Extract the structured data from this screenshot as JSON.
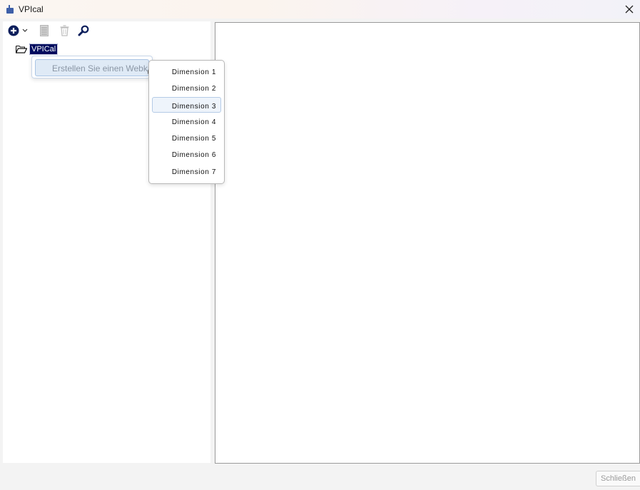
{
  "window": {
    "title": "VPIcal",
    "icon": "app-thumb-icon",
    "close_icon": "close-icon"
  },
  "toolbar": {
    "add_icon": "plus-circle-icon",
    "add_dropdown_icon": "chevron-down-icon",
    "edit_icon": "document-icon",
    "delete_icon": "trash-icon",
    "search_icon": "magnifier-icon"
  },
  "tree": {
    "root_icon": "open-folder-icon",
    "root_label": "VPICal"
  },
  "context_menu": {
    "items": [
      {
        "label": "Erstellen Sie einen Webkalender",
        "has_submenu": true
      }
    ]
  },
  "submenu": {
    "items": [
      {
        "label": "Dimension 1",
        "highlighted": false
      },
      {
        "label": "Dimension 2",
        "highlighted": false
      },
      {
        "label": "Dimension 3",
        "highlighted": true
      },
      {
        "label": "Dimension 4",
        "highlighted": false
      },
      {
        "label": "Dimension 5",
        "highlighted": false
      },
      {
        "label": "Dimension 6",
        "highlighted": false
      },
      {
        "label": "Dimension 7",
        "highlighted": false
      }
    ]
  },
  "footer": {
    "close_label": "Schließen"
  },
  "colors": {
    "selection": "#000c5e",
    "icon_navy": "#0b1f5c",
    "menu_highlight": "#dfeaf6"
  }
}
